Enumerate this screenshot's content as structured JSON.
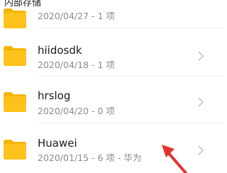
{
  "breadcrumb": "内部存储",
  "folders": [
    {
      "name": "",
      "meta": "2020/04/27 - 1 项"
    },
    {
      "name": "hiidosdk",
      "meta": "2020/04/18 - 1 项"
    },
    {
      "name": "hrslog",
      "meta": "2020/04/20 - 0 项"
    },
    {
      "name": "Huawei",
      "meta": "2020/01/15 - 6 项 - 华为"
    }
  ],
  "icons": {
    "folder": "folder-icon",
    "chevron": "chevron-right-icon"
  },
  "colors": {
    "folder": "#FFC21C",
    "folder_tab": "#F5B400",
    "annotation_arrow": "#E5322D",
    "meta_text": "#8a8a8a",
    "chevron": "#c4c4c4"
  }
}
